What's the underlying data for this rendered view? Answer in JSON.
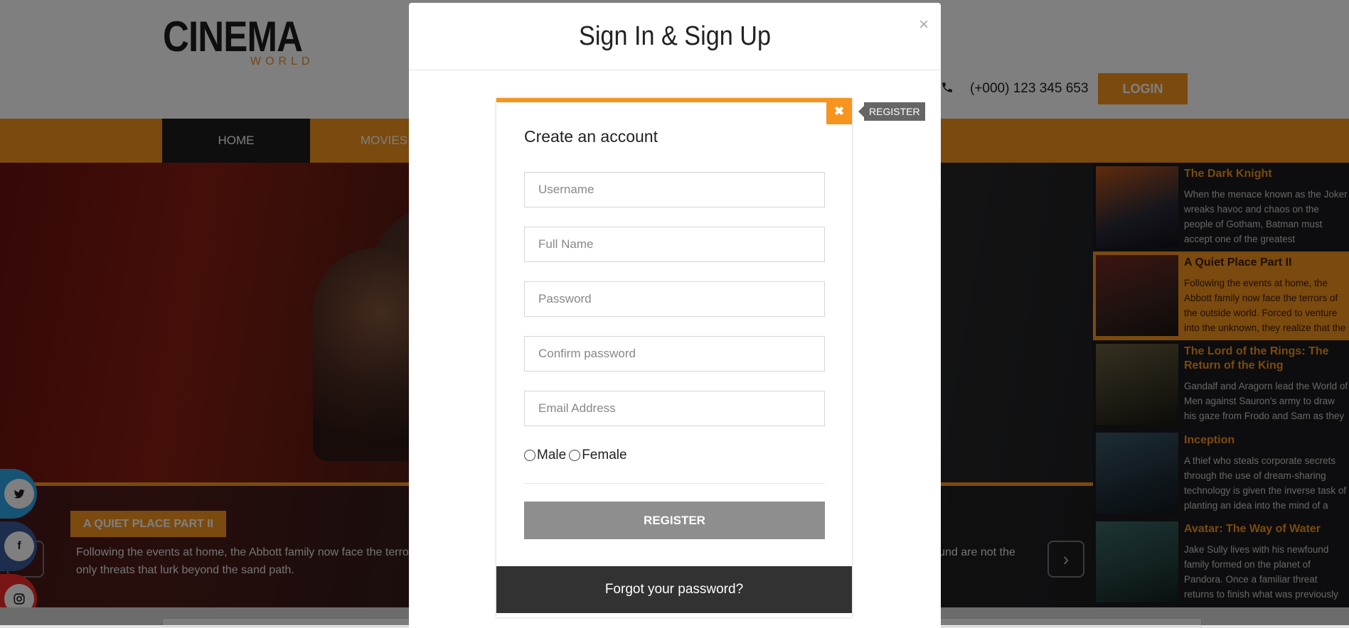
{
  "header": {
    "logo_main": "CINEMA",
    "logo_sub": "WORLD",
    "phone": "(+000) 123 345 653",
    "login_label": "LOGIN"
  },
  "nav": {
    "items": [
      {
        "label": "HOME"
      },
      {
        "label": "MOVIES"
      }
    ]
  },
  "hero": {
    "tag": "A QUIET PLACE PART II",
    "description": "Following the events at home, the Abbott family now face the terrors of the outside world. Forced to venture into the unknown, they realize that the creatures that hunt by sound are not the only threats that lurk beyond the sand path.",
    "prev_icon": "chevron-left-icon",
    "next_icon": "chevron-right-icon"
  },
  "sidebar": {
    "items": [
      {
        "title": "The Dark Knight",
        "desc": "When the menace known as the Joker wreaks havoc and chaos on the people of Gotham, Batman must accept one of the greatest psychological and physical tests",
        "active": false
      },
      {
        "title": "A Quiet Place Part II",
        "desc": "Following the events at home, the Abbott family now face the terrors of the outside world. Forced to venture into the unknown, they realize that the creatures that hunt by",
        "active": true
      },
      {
        "title": "The Lord of the Rings: The Return of the King",
        "desc": "Gandalf and Aragorn lead the World of Men against Sauron's army to draw his gaze from Frodo and Sam as they approach Mount Doom with the One Ring.",
        "active": false
      },
      {
        "title": "Inception",
        "desc": "A thief who steals corporate secrets through the use of dream-sharing technology is given the inverse task of planting an idea into the mind of a C.E.O., but his tragic...",
        "active": false
      },
      {
        "title": "Avatar: The Way of Water",
        "desc": "Jake Sully lives with his newfound family formed on the planet of Pandora. Once a familiar threat returns to finish what was previously started, Jake must work with...",
        "active": false
      }
    ]
  },
  "social": {
    "twitter": "twitter-icon",
    "facebook": "facebook-icon",
    "instagram": "instagram-icon"
  },
  "modal": {
    "title": "Sign In & Sign Up",
    "close": "×"
  },
  "form": {
    "close_label": "✖",
    "tip_label": "REGISTER",
    "heading": "Create an account",
    "username_placeholder": "Username",
    "fullname_placeholder": "Full Name",
    "password_placeholder": "Password",
    "confirm_placeholder": "Confirm password",
    "email_placeholder": "Email Address",
    "male_label": "Male",
    "female_label": "Female",
    "register_label": "REGISTER",
    "forgot_label": "Forgot your password?"
  },
  "colors": {
    "accent": "#f7941e",
    "dark": "#1c1c1c"
  }
}
